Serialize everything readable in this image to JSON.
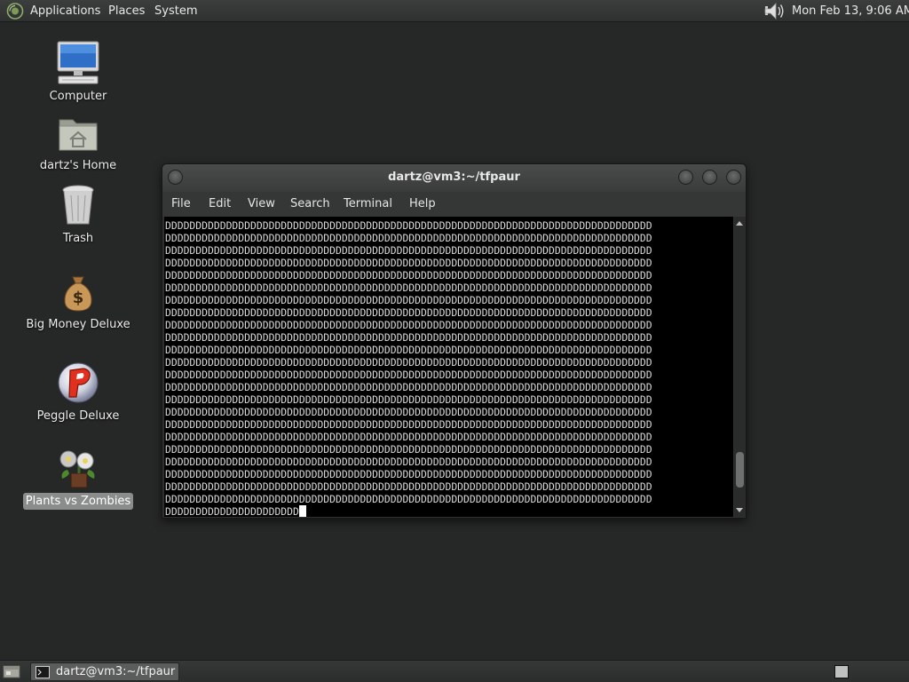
{
  "top_panel": {
    "menus": [
      "Applications",
      "Places",
      "System"
    ],
    "clock": "Mon Feb 13,  9:06 AM",
    "icons": [
      "gnome-foot-icon",
      "volume-icon"
    ]
  },
  "desktop": {
    "icons": [
      {
        "label": "Computer",
        "icon": "computer-icon",
        "selected": false
      },
      {
        "label": "dartz's Home",
        "icon": "home-folder-icon",
        "selected": false
      },
      {
        "label": "Trash",
        "icon": "trash-icon",
        "selected": false
      },
      {
        "label": "Big Money Deluxe",
        "icon": "money-bag-icon",
        "selected": false
      },
      {
        "label": "Peggle Deluxe",
        "icon": "peggle-icon",
        "selected": false
      },
      {
        "label": "Plants vs Zombies",
        "icon": "plants-vs-zombies-icon",
        "selected": true
      }
    ]
  },
  "terminal": {
    "title": "dartz@vm3:~/tfpaur",
    "menu": [
      "File",
      "Edit",
      "View",
      "Search",
      "Terminal",
      "Help"
    ],
    "fill_char": "D",
    "full_lines": 23,
    "chars_per_line": 80,
    "last_line": "DDDDDDDDDDDDDDDDDDDDDD",
    "scroll_position": 0.93
  },
  "taskbar": {
    "tasks": [
      {
        "label": "dartz@vm3:~/tfpaur",
        "icon": "terminal-icon"
      }
    ]
  },
  "colors": {
    "desktop_bg": "#262827",
    "terminal_bg": "#000000",
    "terminal_fg": "#d8d8d8",
    "selection_bg": "#8b8d8c"
  }
}
